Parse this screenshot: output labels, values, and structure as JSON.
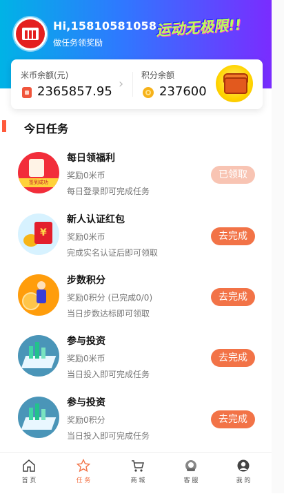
{
  "header": {
    "greeting": "Hi,15810581058",
    "subtitle": "做任务领奖励",
    "slogan": "运动无极限!!",
    "colors": {
      "gradient_start": "#00b3e6",
      "gradient_end": "#7a2cff"
    }
  },
  "balances": {
    "coin_label": "米币余额(元)",
    "coin_value": "2365857.95",
    "points_label": "积分余额",
    "points_value": "237600",
    "chevron_icon": "chevron-right-icon",
    "chest_icon": "treasure-chest-icon"
  },
  "section": {
    "title": "今日任务",
    "accent": "#ff5a3c"
  },
  "tasks": [
    {
      "title": "每日领福利",
      "reward": "奖励0米币",
      "desc": "每日登录即可完成任务",
      "button": "已领取",
      "done": true,
      "icon": "sign-in-icon",
      "badge": "签到成功"
    },
    {
      "title": "新人认证红包",
      "reward": "奖励0米币",
      "desc": "完成实名认证后即可领取",
      "button": "去完成",
      "done": false,
      "icon": "red-envelope-icon"
    },
    {
      "title": "步数积分",
      "reward": "奖励0积分  (已完成0/0)",
      "desc": "当日步数达标即可领取",
      "button": "去完成",
      "done": false,
      "icon": "runner-icon"
    },
    {
      "title": "参与投资",
      "reward": "奖励0米币",
      "desc": "当日投入即可完成任务",
      "button": "去完成",
      "done": false,
      "icon": "investment-icon"
    },
    {
      "title": "参与投资",
      "reward": "奖励0积分",
      "desc": "当日投入即可完成任务",
      "button": "去完成",
      "done": false,
      "icon": "investment-icon"
    }
  ],
  "nav": [
    {
      "label": "首 页",
      "icon": "home-icon",
      "active": false
    },
    {
      "label": "任 务",
      "icon": "star-icon",
      "active": true
    },
    {
      "label": "商 城",
      "icon": "cart-icon",
      "active": false
    },
    {
      "label": "客 服",
      "icon": "support-icon",
      "active": false
    },
    {
      "label": "我 的",
      "icon": "user-icon",
      "active": false
    }
  ],
  "accent_button": "#f27347"
}
